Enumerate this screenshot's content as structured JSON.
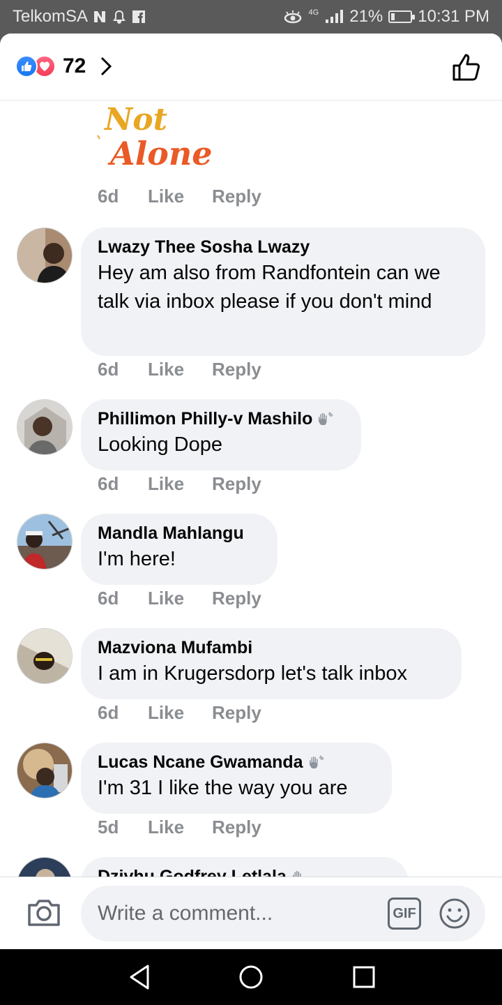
{
  "status_bar": {
    "carrier": "TelkomSA",
    "network": "4G",
    "battery": "21%",
    "battery_level": 0.21,
    "time": "10:31 PM"
  },
  "header": {
    "reaction_count": "72",
    "reactions": [
      "like-icon",
      "love-icon"
    ]
  },
  "top_comment_meta": {
    "time": "6d",
    "like": "Like",
    "reply": "Reply"
  },
  "comments": [
    {
      "author": "Lwazy Thee Sosha Lwazy",
      "badge": false,
      "text": "Hey am also from Randfontein can we talk via inbox please if you don't mind",
      "time": "6d",
      "like": "Like",
      "reply": "Reply"
    },
    {
      "author": "Phillimon Philly-v Mashilo",
      "badge": true,
      "text": "Looking Dope",
      "time": "6d",
      "like": "Like",
      "reply": "Reply"
    },
    {
      "author": "Mandla Mahlangu",
      "badge": false,
      "text": "I'm here!",
      "time": "6d",
      "like": "Like",
      "reply": "Reply"
    },
    {
      "author": "Mazviona Mufambi",
      "badge": false,
      "text": "I am in Krugersdorp let's talk inbox",
      "time": "6d",
      "like": "Like",
      "reply": "Reply"
    },
    {
      "author": "Lucas Ncane Gwamanda",
      "badge": true,
      "text": "I'm 31 I like the way you are",
      "time": "5d",
      "like": "Like",
      "reply": "Reply"
    },
    {
      "author": "Dzivhu Godfrey Letlala",
      "badge": true,
      "text": "",
      "time": "",
      "like": "",
      "reply": ""
    }
  ],
  "composer": {
    "placeholder": "Write a comment...",
    "gif_label": "GIF"
  },
  "colors": {
    "like_blue": "#1877f2",
    "love_red": "#f33e58",
    "bubble_bg": "#f0f2f5",
    "meta_gray": "#8a8d91"
  }
}
